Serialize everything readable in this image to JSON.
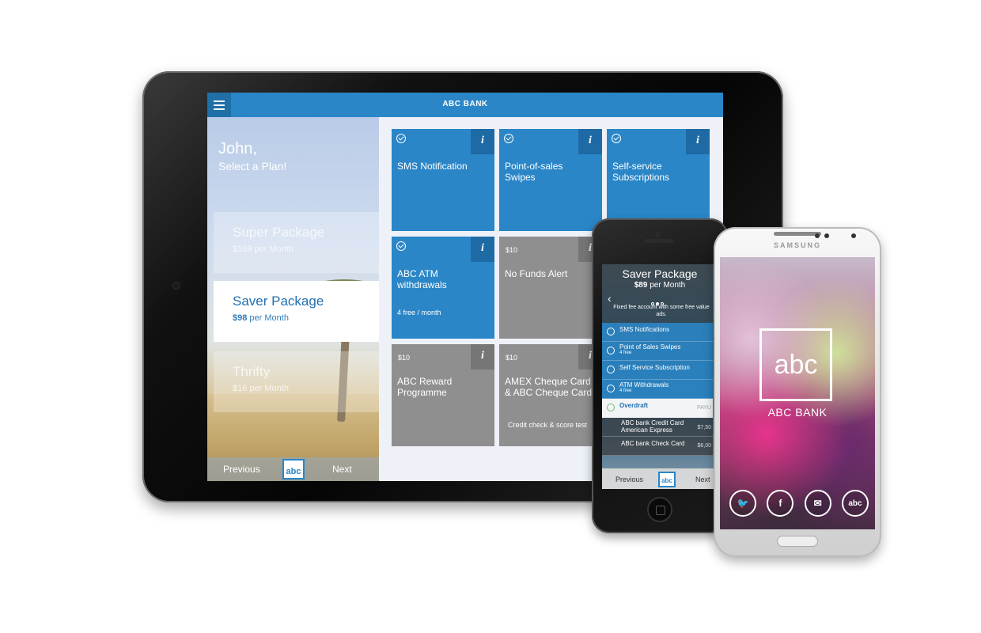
{
  "tablet": {
    "app_title": "ABC BANK",
    "greeting_name": "John,",
    "greeting_sub": "Select a Plan!",
    "plans": [
      {
        "name": "Super Package",
        "price": "$169 per Month"
      },
      {
        "name": "Saver Package",
        "price_bold": "$98",
        "price_rest": " per Month"
      },
      {
        "name": "Thrifty",
        "price": "$16 per Month"
      }
    ],
    "prev_label": "Previous",
    "next_label": "Next",
    "logo_text": "abc",
    "tiles": [
      {
        "name": "SMS Notification"
      },
      {
        "name": "Point-of-sales Swipes"
      },
      {
        "name": "Self-service Subscriptions"
      },
      {
        "name": "ABC ATM withdrawals",
        "note": "4 free / month"
      },
      {
        "price": "$10",
        "name": "No Funds Alert"
      },
      {
        "price": "$10",
        "name": "ABC Reward Programme"
      },
      {
        "price": "$10",
        "name": "AMEX Cheque Card & ABC Cheque Card",
        "note": "Credit check & score test"
      }
    ],
    "info_glyph": "i"
  },
  "iphone": {
    "title": "Saver Package",
    "price_bold": "$89",
    "price_rest": " per Month",
    "description": "Fixed fee account with some free value ads.",
    "back_glyph": "‹",
    "items": [
      {
        "label": "SMS Notifications"
      },
      {
        "label": "Point of Sales Swipes",
        "sub": "4 free"
      },
      {
        "label": "Self Service Subscription"
      },
      {
        "label": "ATM Withdrawals",
        "sub": "4 free"
      },
      {
        "label": "Overdraft",
        "amount": "PAYU"
      },
      {
        "label": "ABC bank Credit Card American Express",
        "amount": "$7,50"
      },
      {
        "label": "ABC bank Check Card",
        "amount": "$6,00"
      }
    ],
    "prev_label": "Previous",
    "next_label": "Next",
    "logo_text": "abc"
  },
  "samsung": {
    "brand": "SAMSUNG",
    "logo_text": "abc",
    "bank_name": "ABC BANK",
    "social_icons": [
      "twitter-icon",
      "facebook-icon",
      "mail-icon",
      "abc-icon"
    ],
    "social_glyphs": [
      "🐦",
      "f",
      "✉",
      "abc"
    ]
  }
}
